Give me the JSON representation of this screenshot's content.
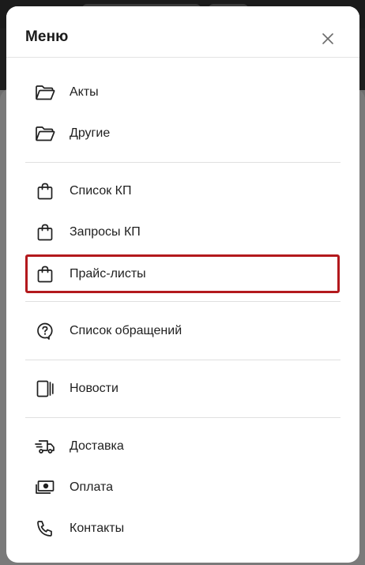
{
  "menu": {
    "title": "Меню",
    "items": [
      {
        "label": "Акты",
        "icon": "folder-icon"
      },
      {
        "label": "Другие",
        "icon": "folder-icon"
      },
      {
        "label": "Список КП",
        "icon": "shopping-bag-icon"
      },
      {
        "label": "Запросы КП",
        "icon": "shopping-bag-icon"
      },
      {
        "label": "Прайс-листы",
        "icon": "shopping-bag-icon",
        "active": true
      },
      {
        "label": "Список обращений",
        "icon": "question-chat-icon"
      },
      {
        "label": "Новости",
        "icon": "news-icon"
      },
      {
        "label": "Доставка",
        "icon": "delivery-truck-icon"
      },
      {
        "label": "Оплата",
        "icon": "payment-cash-icon"
      },
      {
        "label": "Контакты",
        "icon": "phone-icon"
      }
    ]
  },
  "colors": {
    "active_outline": "#b3191d",
    "text": "#1f1f1f",
    "divider": "#e0e0e0"
  }
}
